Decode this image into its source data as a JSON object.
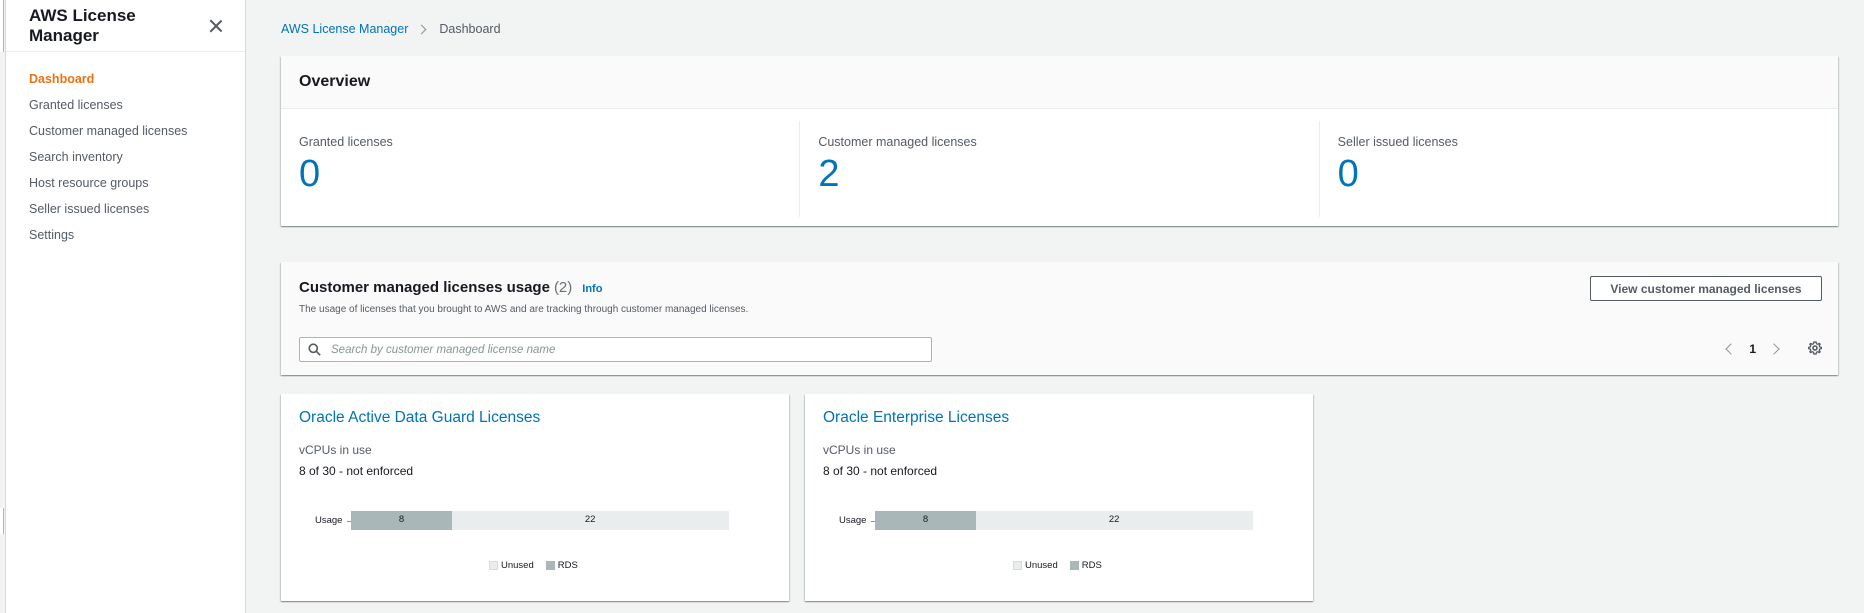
{
  "sidebar": {
    "title": "AWS License Manager",
    "items": [
      {
        "label": "Dashboard",
        "active": true
      },
      {
        "label": "Granted licenses"
      },
      {
        "label": "Customer managed licenses"
      },
      {
        "label": "Search inventory"
      },
      {
        "label": "Host resource groups"
      },
      {
        "label": "Seller issued licenses"
      },
      {
        "label": "Settings"
      }
    ]
  },
  "breadcrumb": {
    "root": "AWS License Manager",
    "current": "Dashboard"
  },
  "overview": {
    "title": "Overview",
    "stats": [
      {
        "label": "Granted licenses",
        "value": "0"
      },
      {
        "label": "Customer managed licenses",
        "value": "2"
      },
      {
        "label": "Seller issued licenses",
        "value": "0"
      }
    ]
  },
  "usage": {
    "title": "Customer managed licenses usage",
    "count": "(2)",
    "info": "Info",
    "description": "The usage of licenses that you brought to AWS and are tracking through customer managed licenses.",
    "view_button": "View customer managed licenses",
    "search_placeholder": "Search by customer managed license name",
    "page": "1"
  },
  "cards": [
    {
      "title": "Oracle Active Data Guard Licenses",
      "subtitle": "vCPUs in use",
      "value": "8 of 30 - not enforced",
      "bar_label": "Usage",
      "used": 8,
      "unused": 22,
      "total": 30,
      "used_label": "8",
      "unused_label": "22",
      "legend": [
        "Unused",
        "RDS"
      ]
    },
    {
      "title": "Oracle Enterprise Licenses",
      "subtitle": "vCPUs in use",
      "value": "8 of 30 - not enforced",
      "bar_label": "Usage",
      "used": 8,
      "unused": 22,
      "total": 30,
      "used_label": "8",
      "unused_label": "22",
      "legend": [
        "Unused",
        "RDS"
      ]
    }
  ],
  "colors": {
    "link": "#0073bb",
    "active": "#ec7211",
    "bar_used": "#aab7b8",
    "bar_unused": "#eaeded"
  }
}
